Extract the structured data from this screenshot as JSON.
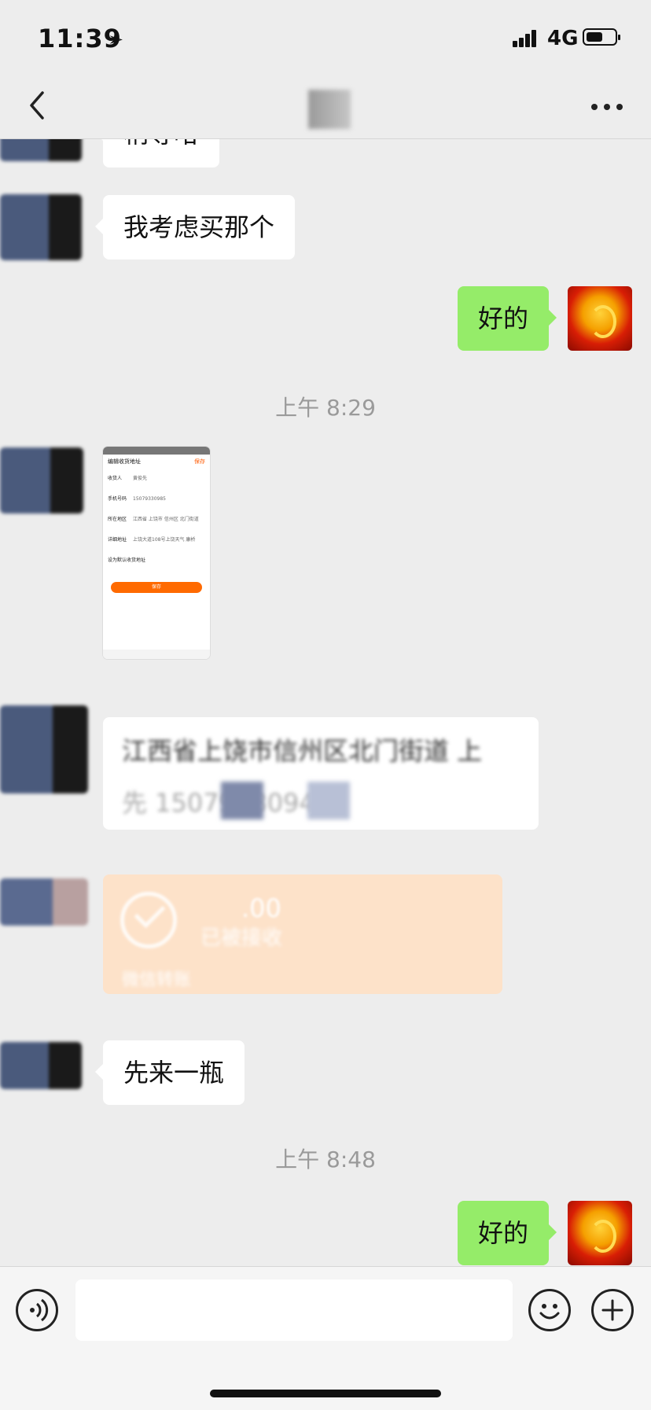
{
  "status_bar": {
    "time": "11:39",
    "location_icon": "location-arrow-icon",
    "network": "4G",
    "battery_level": 0.6
  },
  "nav": {
    "title": "",
    "back_icon": "chevron-left-icon",
    "more_icon": "more-dots-icon"
  },
  "messages": {
    "m0_partial": "稍等哈",
    "m1": "我考虑买那个",
    "m2": "好的",
    "time1": "上午 8:29",
    "screenshot": {
      "header": "编辑收货地址",
      "save": "保存",
      "rows": [
        {
          "label": "收货人",
          "value": "黄俊先"
        },
        {
          "label": "手机号码",
          "value": "15079330985"
        },
        {
          "label": "所在地区",
          "value": "江西省 上饶市 信州区 北门街道"
        },
        {
          "label": "详细地址",
          "value": "上饶大道108号上饶天气 康桥"
        },
        {
          "label": "设为默认收货地址",
          "value": ""
        }
      ],
      "button": "保存"
    },
    "address_line1": "江西省上饶市信州区北门街道 上",
    "address_line2": "先  15079330940",
    "transfer": {
      "amount": ".00",
      "status": "已被接收",
      "footer": "微信转账"
    },
    "m3": "先来一瓶",
    "time2": "上午 8:48",
    "m4": "好的"
  },
  "input_bar": {
    "voice_icon": "voice-icon",
    "emoji_icon": "emoji-icon",
    "plus_icon": "plus-icon",
    "placeholder": ""
  },
  "colors": {
    "background": "#ededed",
    "my_bubble": "#95ec69",
    "transfer_card": "#fde2c9"
  }
}
